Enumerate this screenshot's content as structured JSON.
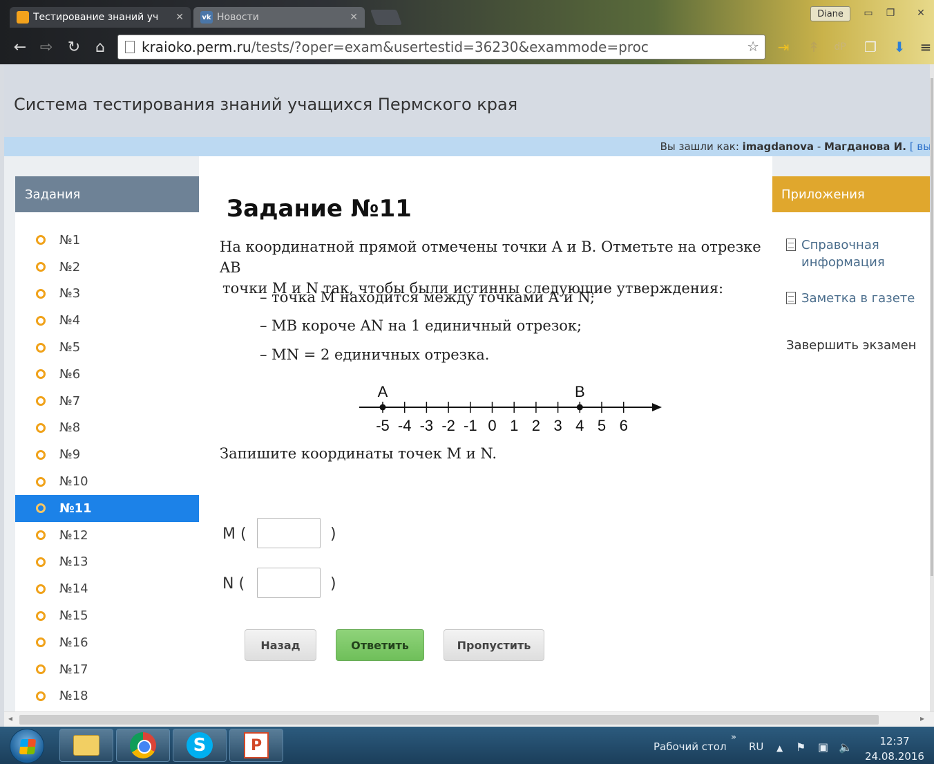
{
  "browser": {
    "tabs": [
      {
        "title": "Тестирование знаний уч",
        "favicon": "orange-cube-icon",
        "active": true
      },
      {
        "title": "Новости",
        "favicon": "vk-icon",
        "active": false
      }
    ],
    "user": "Diane",
    "url_host": "kraioko.perm.ru",
    "url_path": "/tests/?oper=exam&usertestid=36230&exammode=proc"
  },
  "site": {
    "title": "Система тестирования знаний учащихся Пермского края",
    "login_prefix": "Вы зашли как:",
    "login_user": "imagdanova",
    "login_dash": "-",
    "login_name": "Магданова И.",
    "logout_text": "[ вы"
  },
  "tasks_panel": {
    "title": "Задания",
    "items": [
      "№1",
      "№2",
      "№3",
      "№4",
      "№5",
      "№6",
      "№7",
      "№8",
      "№9",
      "№10",
      "№11",
      "№12",
      "№13",
      "№14",
      "№15",
      "№16",
      "№17",
      "№18"
    ],
    "active_index": 10
  },
  "task": {
    "title": "Задание №11",
    "line1": "На координатной прямой отмечены точки A и B. Отметьте на отрезке AB",
    "line2": "точки M и N так, чтобы были истинны следующие утверждения:",
    "conditions": [
      "– точка  M находится между точками A и N;",
      "– MB короче AN на 1 единичный отрезок;",
      "– MN = 2 единичных отрезка."
    ],
    "number_line": {
      "ticks": [
        "-5",
        "-4",
        "-3",
        "-2",
        "-1",
        "0",
        "1",
        "2",
        "3",
        "4",
        "5",
        "6"
      ],
      "point_a": {
        "label": "A",
        "value": -5
      },
      "point_b": {
        "label": "B",
        "value": 4
      }
    },
    "question": "Запишите координаты точек M и N.",
    "answer_m_label": "M (",
    "answer_n_label": "N (",
    "close_paren": ")",
    "answer_m_value": "",
    "answer_n_value": "",
    "buttons": {
      "back": "Назад",
      "answer": "Ответить",
      "skip": "Пропустить"
    }
  },
  "apps_panel": {
    "title": "Приложения",
    "ref_line1": "Справочная",
    "ref_line2": "информация",
    "note": "Заметка в газете",
    "finish": "Завершить экзамен"
  },
  "taskbar": {
    "desktop": "Рабочий стол",
    "lang": "RU",
    "time": "12:37",
    "date": "24.08.2016"
  },
  "colors": {
    "active_task": "#1c82e8",
    "tasks_header": "#6e8296",
    "apps_header": "#e0a72d",
    "answer_button": "#7ac764"
  }
}
